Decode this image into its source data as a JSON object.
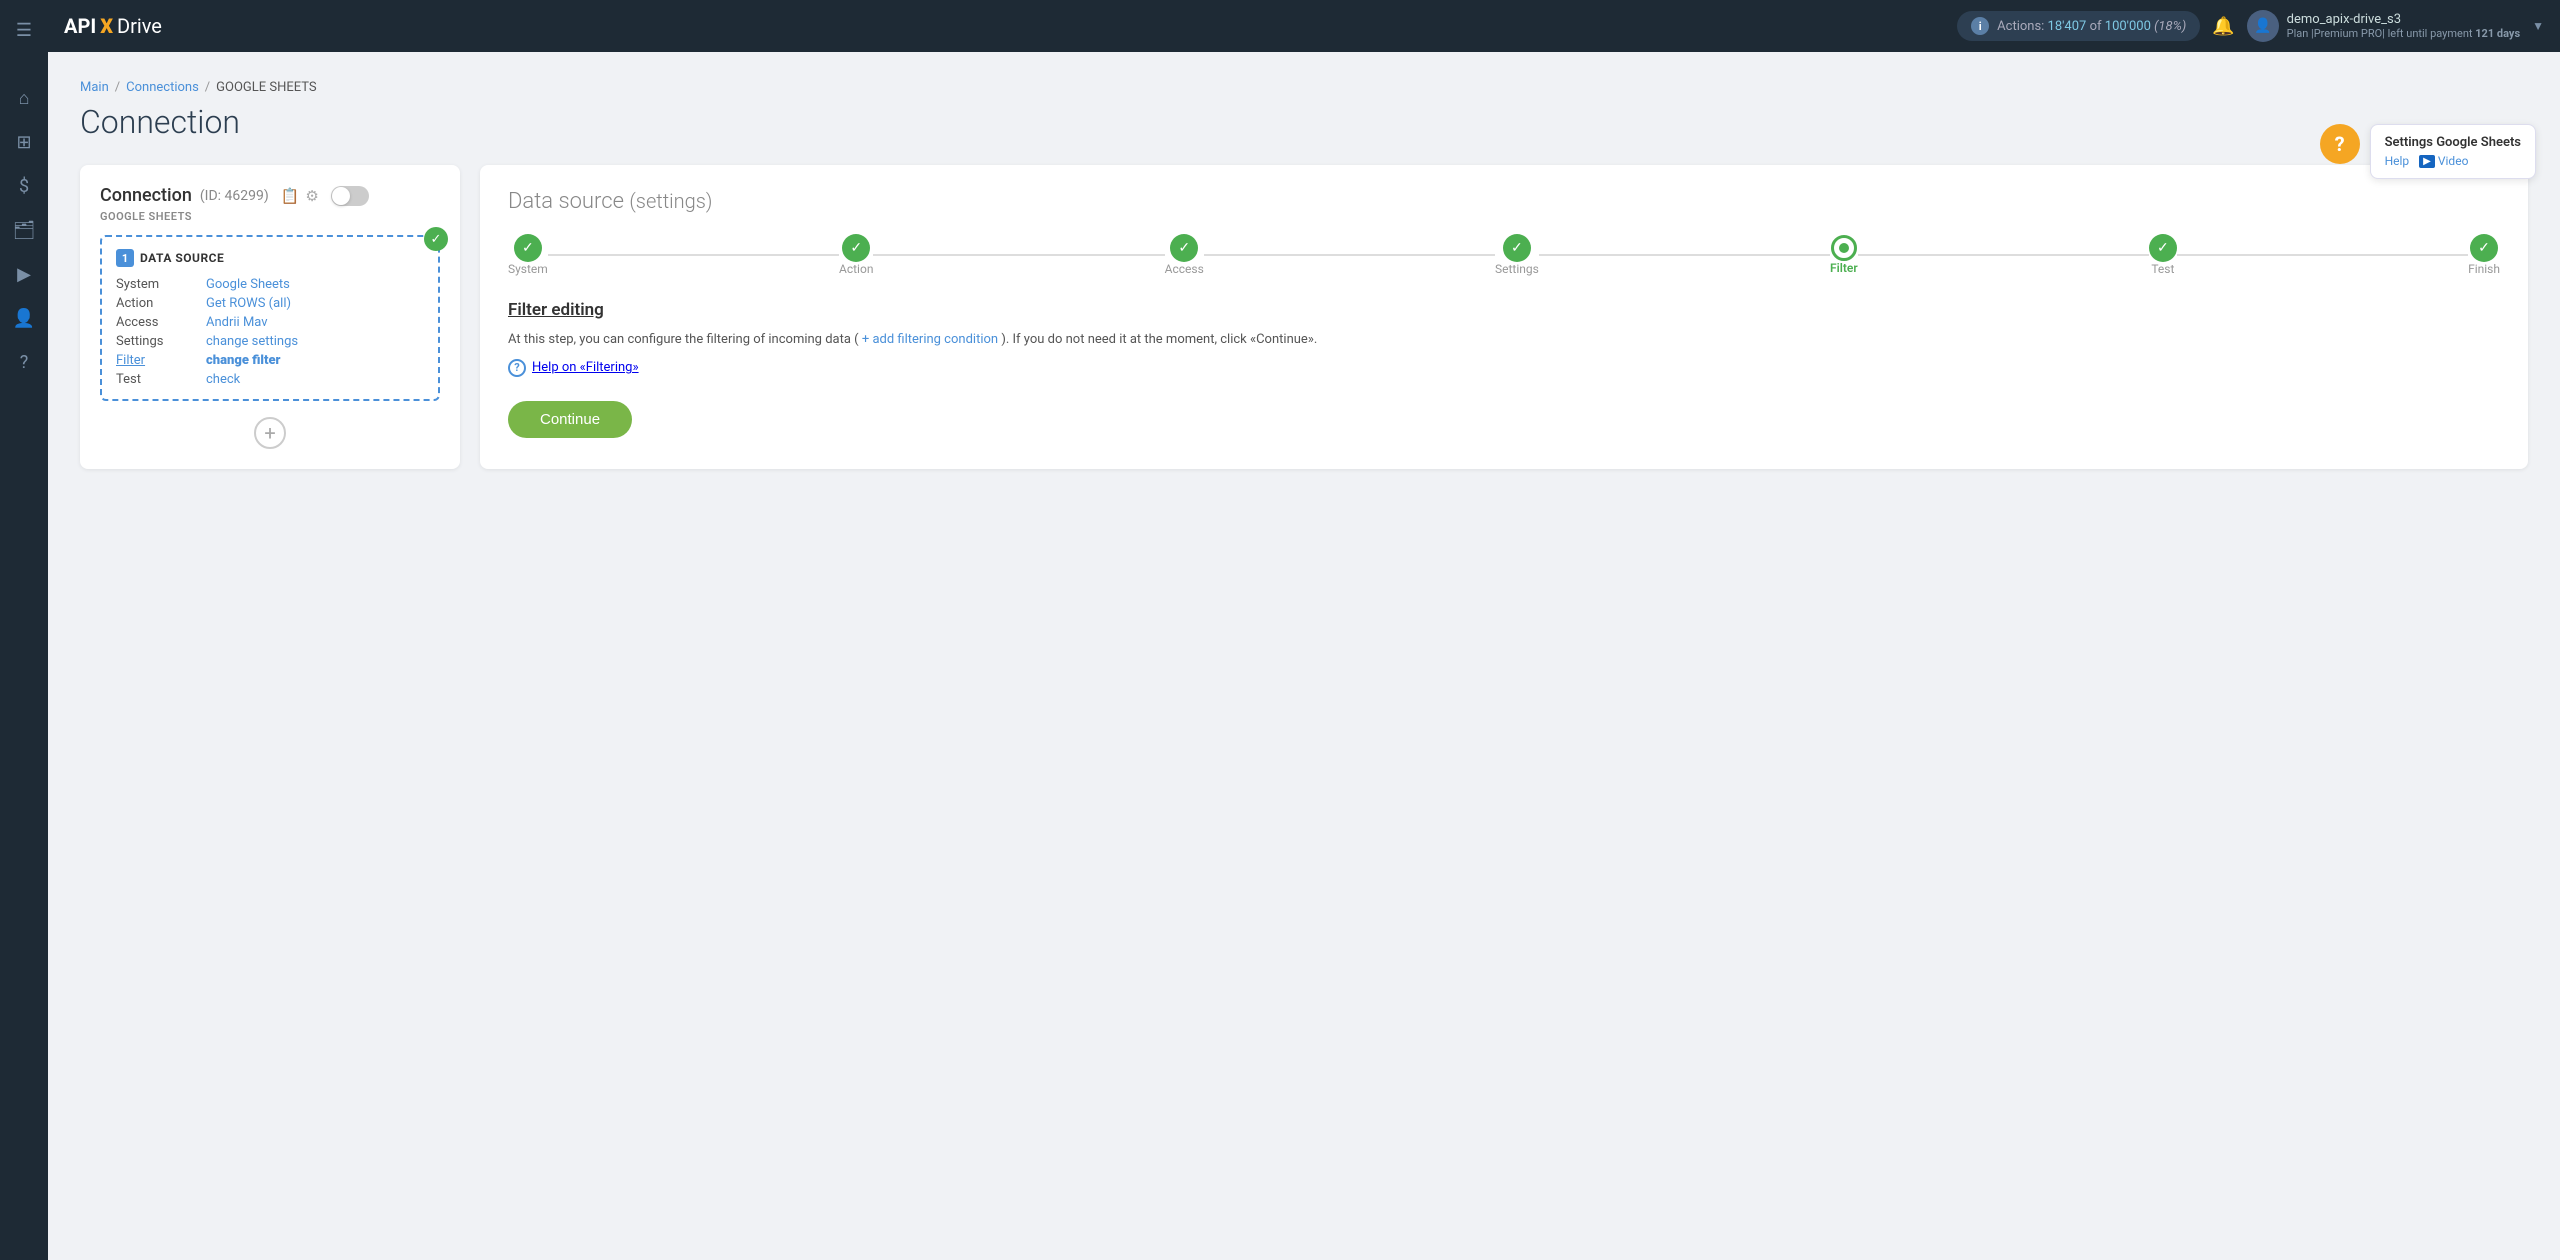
{
  "brand": {
    "api": "API",
    "x": "X",
    "drive": "Drive"
  },
  "navbar": {
    "actions_label": "Actions:",
    "actions_count": "18'407",
    "actions_of": "of",
    "actions_total": "100'000",
    "actions_pct": "(18%)",
    "user_name": "demo_apix-drive_s3",
    "plan_label": "Plan |Premium PRO| left until payment",
    "plan_days": "121 days"
  },
  "help": {
    "title": "Settings Google Sheets",
    "help_link": "Help",
    "video_link": "Video",
    "question_mark": "?"
  },
  "breadcrumb": {
    "main": "Main",
    "connections": "Connections",
    "current": "GOOGLE SHEETS"
  },
  "page": {
    "title": "Connection"
  },
  "connection_card": {
    "title": "Connection",
    "id_label": "(ID: 46299)",
    "subtitle": "GOOGLE SHEETS",
    "datasource_num": "1",
    "datasource_label": "DATA SOURCE",
    "rows": [
      {
        "key": "System",
        "value": "Google Sheets",
        "type": "link"
      },
      {
        "key": "Action",
        "value": "Get ROWS (all)",
        "type": "link"
      },
      {
        "key": "Access",
        "value": "Andrii Mav",
        "type": "link"
      },
      {
        "key": "Settings",
        "value": "change settings",
        "type": "link"
      },
      {
        "key": "Filter",
        "value": "change filter",
        "type": "link-bold"
      },
      {
        "key": "Test",
        "value": "check",
        "type": "link"
      }
    ],
    "add_label": "+"
  },
  "settings_panel": {
    "title": "Data source",
    "title_sub": "(settings)",
    "steps": [
      {
        "label": "System",
        "state": "done"
      },
      {
        "label": "Action",
        "state": "done"
      },
      {
        "label": "Access",
        "state": "done"
      },
      {
        "label": "Settings",
        "state": "done"
      },
      {
        "label": "Filter",
        "state": "active"
      },
      {
        "label": "Test",
        "state": "done"
      },
      {
        "label": "Finish",
        "state": "done"
      }
    ],
    "filter_title": "Filter editing",
    "filter_desc_1": "At this step, you can configure the filtering of incoming data (",
    "filter_add_link": "+ add filtering condition",
    "filter_desc_2": "). If you do not need it at the moment, click «Continue».",
    "filter_help_text": "Help on «Filtering»",
    "continue_label": "Continue"
  },
  "sidebar": {
    "icons": [
      {
        "name": "menu-icon",
        "symbol": "☰"
      },
      {
        "name": "home-icon",
        "symbol": "⌂"
      },
      {
        "name": "connections-icon",
        "symbol": "⊞"
      },
      {
        "name": "dollar-icon",
        "symbol": "$"
      },
      {
        "name": "briefcase-icon",
        "symbol": "💼"
      },
      {
        "name": "youtube-icon",
        "symbol": "▶"
      },
      {
        "name": "user-icon",
        "symbol": "👤"
      },
      {
        "name": "help-icon",
        "symbol": "?"
      }
    ]
  }
}
